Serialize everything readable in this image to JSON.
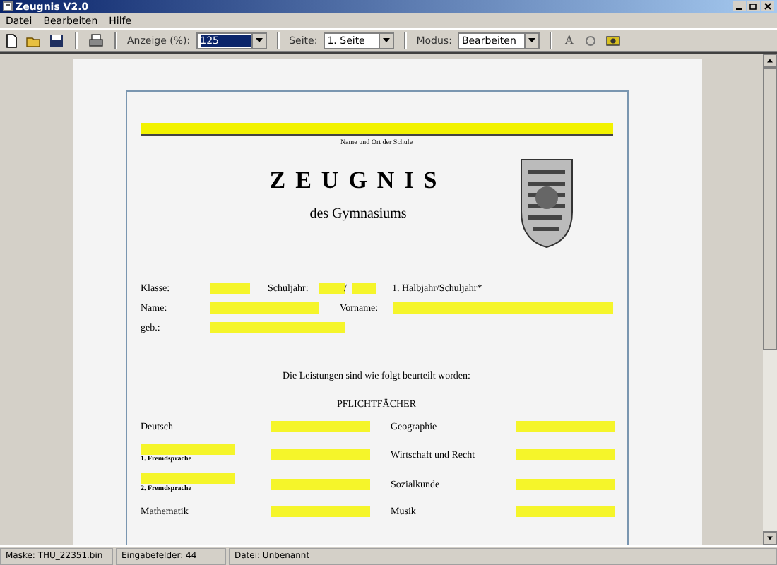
{
  "window": {
    "title": "Zeugnis V2.0"
  },
  "menu": [
    "Datei",
    "Bearbeiten",
    "Hilfe"
  ],
  "toolbar": {
    "zoom_label": "Anzeige (%):",
    "zoom_value": "125",
    "page_label": "Seite:",
    "page_value": "1. Seite",
    "mode_label": "Modus:",
    "mode_value": "Bearbeiten",
    "font_button": "A"
  },
  "document": {
    "school_caption": "Name und Ort der Schule",
    "title": "ZEUGNIS",
    "subtitle": "des Gymnasiums",
    "klasse_label": "Klasse:",
    "schuljahr_label": "Schuljahr:",
    "schuljahr_separator": "/",
    "halbjahr_text": "1. Halbjahr/Schuljahr*",
    "name_label": "Name:",
    "vorname_label": "Vorname:",
    "geb_label": "geb.:",
    "intro": "Die Leistungen sind wie folgt beurteilt worden:",
    "section_title": "PFLICHTFÄCHER",
    "subjects": [
      {
        "left": {
          "kind": "subject",
          "label": "Deutsch"
        },
        "right": "Geographie"
      },
      {
        "left": {
          "kind": "language",
          "label": "1. Fremdsprache"
        },
        "right": "Wirtschaft und Recht"
      },
      {
        "left": {
          "kind": "language",
          "label": "2. Fremdsprache"
        },
        "right": "Sozialkunde"
      },
      {
        "left": {
          "kind": "subject",
          "label": "Mathematik"
        },
        "right": "Musik"
      }
    ]
  },
  "status_bar": [
    "Maske: THU_22351.bin",
    "Eingabefelder: 44",
    "Datei: Unbenannt"
  ]
}
